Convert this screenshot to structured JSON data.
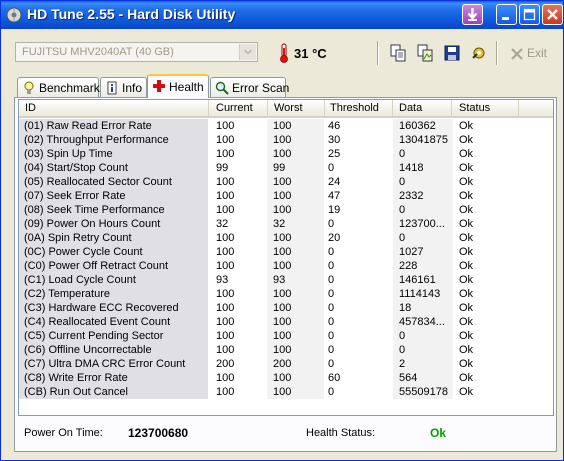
{
  "window": {
    "title": "HD Tune 2.55 - Hard Disk Utility",
    "icons": [
      "download-arrow-icon",
      "minimize-icon",
      "maximize-icon",
      "close-icon"
    ]
  },
  "toolbar": {
    "drive": "FUJITSU MHV2040AT (40 GB)",
    "temperature": "31 °C",
    "exit_label": "Exit",
    "icons": [
      "copy-text-icon",
      "copy-screenshot-icon",
      "save-icon",
      "options-icon"
    ]
  },
  "tabs": [
    {
      "label": "Benchmark",
      "icon": "lightbulb-icon",
      "active": false
    },
    {
      "label": "Info",
      "icon": "info-icon",
      "active": false
    },
    {
      "label": "Health",
      "icon": "health-cross-icon",
      "active": true
    },
    {
      "label": "Error Scan",
      "icon": "magnifier-icon",
      "active": false
    }
  ],
  "table": {
    "columns": [
      "ID",
      "Current",
      "Worst",
      "Threshold",
      "Data",
      "Status"
    ],
    "rows": [
      [
        "(01) Raw Read Error Rate",
        "100",
        "100",
        "46",
        "160362",
        "Ok"
      ],
      [
        "(02) Throughput Performance",
        "100",
        "100",
        "30",
        "13041875",
        "Ok"
      ],
      [
        "(03) Spin Up Time",
        "100",
        "100",
        "25",
        "0",
        "Ok"
      ],
      [
        "(04) Start/Stop Count",
        "99",
        "99",
        "0",
        "1418",
        "Ok"
      ],
      [
        "(05) Reallocated Sector Count",
        "100",
        "100",
        "24",
        "0",
        "Ok"
      ],
      [
        "(07) Seek Error Rate",
        "100",
        "100",
        "47",
        "2332",
        "Ok"
      ],
      [
        "(08) Seek Time Performance",
        "100",
        "100",
        "19",
        "0",
        "Ok"
      ],
      [
        "(09) Power On Hours Count",
        "32",
        "32",
        "0",
        "123700...",
        "Ok"
      ],
      [
        "(0A) Spin Retry Count",
        "100",
        "100",
        "20",
        "0",
        "Ok"
      ],
      [
        "(0C) Power Cycle Count",
        "100",
        "100",
        "0",
        "1027",
        "Ok"
      ],
      [
        "(C0) Power Off Retract Count",
        "100",
        "100",
        "0",
        "228",
        "Ok"
      ],
      [
        "(C1) Load Cycle Count",
        "93",
        "93",
        "0",
        "146161",
        "Ok"
      ],
      [
        "(C2) Temperature",
        "100",
        "100",
        "0",
        "1114143",
        "Ok"
      ],
      [
        "(C3) Hardware ECC Recovered",
        "100",
        "100",
        "0",
        "18",
        "Ok"
      ],
      [
        "(C4) Reallocated Event Count",
        "100",
        "100",
        "0",
        "457834...",
        "Ok"
      ],
      [
        "(C5) Current Pending Sector",
        "100",
        "100",
        "0",
        "0",
        "Ok"
      ],
      [
        "(C6) Offline Uncorrectable",
        "100",
        "100",
        "0",
        "0",
        "Ok"
      ],
      [
        "(C7) Ultra DMA CRC Error Count",
        "200",
        "200",
        "0",
        "2",
        "Ok"
      ],
      [
        "(C8) Write Error Rate",
        "100",
        "100",
        "60",
        "564",
        "Ok"
      ],
      [
        "(CB) Run Out Cancel",
        "100",
        "100",
        "0",
        "55509178",
        "Ok"
      ]
    ]
  },
  "footer": {
    "power_on_label": "Power On Time:",
    "power_on_value": "123700680",
    "health_label": "Health Status:",
    "health_value": "Ok",
    "health_color": "#00a000"
  }
}
